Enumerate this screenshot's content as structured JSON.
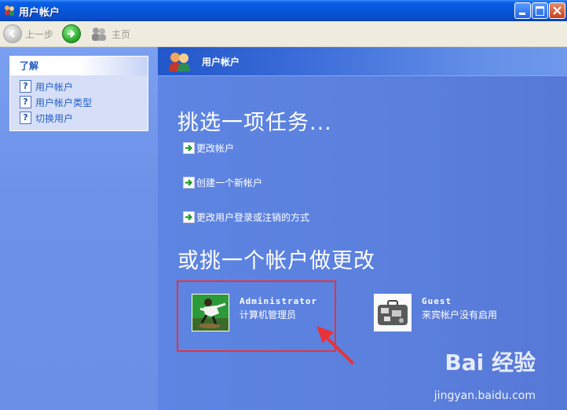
{
  "window": {
    "title": "用户帐户"
  },
  "toolbar": {
    "back_label": "上一步",
    "home_label": "主页"
  },
  "learn": {
    "title": "了解",
    "links": [
      {
        "label": "用户帐户",
        "icon": "help-icon"
      },
      {
        "label": "用户帐户类型",
        "icon": "help-icon"
      },
      {
        "label": "切换用户",
        "icon": "help-icon"
      }
    ]
  },
  "main": {
    "header_title": "用户帐户",
    "pick_task": "挑选一项任务...",
    "tasks": [
      {
        "label": "更改帐户",
        "icon": "green-arrow-icon"
      },
      {
        "label": "创建一个新帐户",
        "icon": "green-arrow-icon"
      },
      {
        "label": "更改用户登录或注销的方式",
        "icon": "green-arrow-icon"
      }
    ],
    "pick_account": "或挑一个帐户做更改",
    "accounts": [
      {
        "name": "Administrator",
        "description": "计算机管理员",
        "picture": "skateboarder-picture"
      },
      {
        "name": "Guest",
        "description": "来宾帐户没有启用",
        "picture": "briefcase-picture"
      }
    ]
  },
  "watermark": {
    "text": "Bai 经验",
    "url": "jingyan.baidu.com"
  },
  "colors": {
    "accent": "#215dc6",
    "highlight": "#e8333a",
    "pane_blue": "#5b7edc"
  }
}
